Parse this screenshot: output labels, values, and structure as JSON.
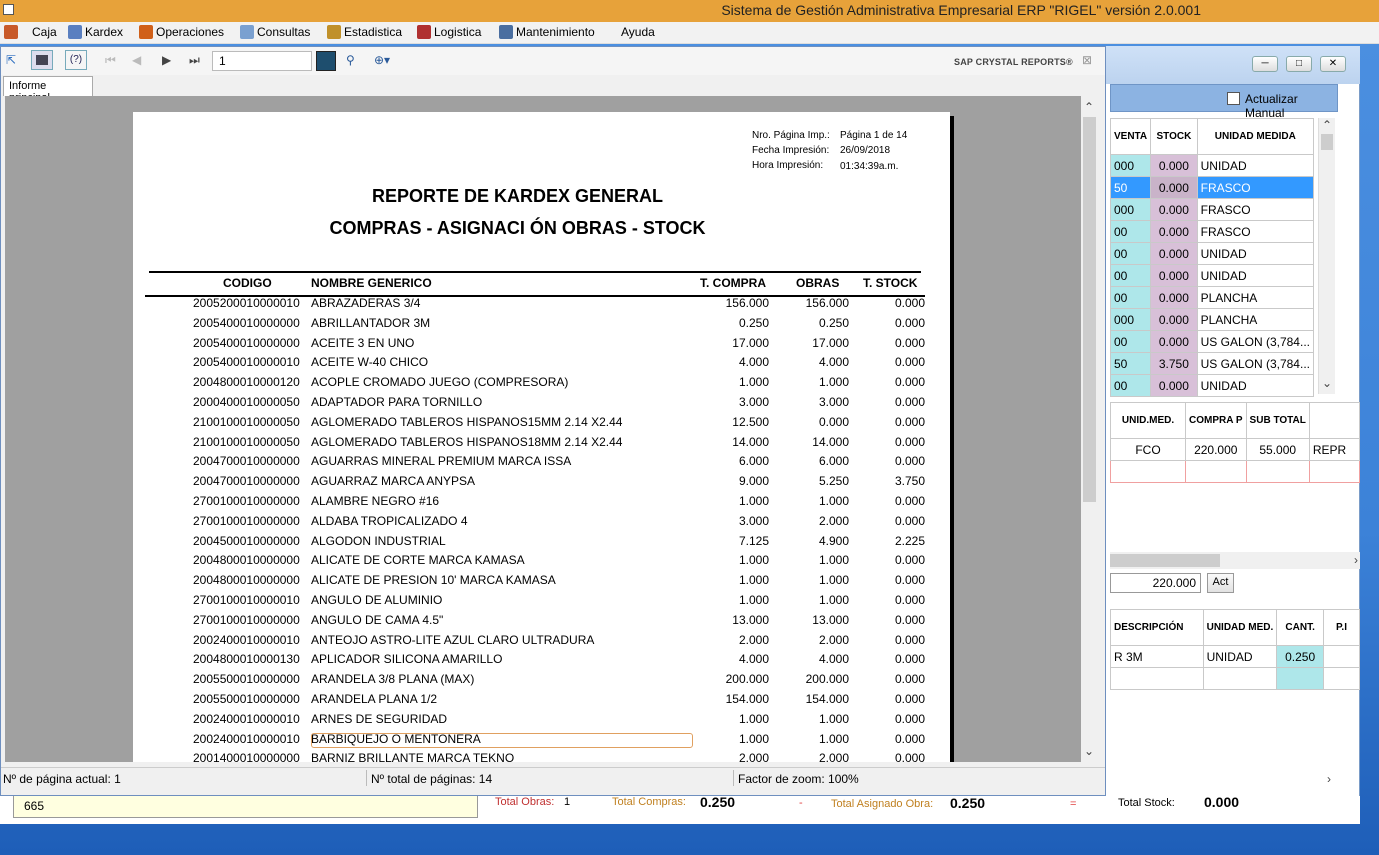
{
  "app": {
    "title": "Sistema de Gestión Administrativa Empresarial ERP  \"RIGEL\" versión 2.0.001"
  },
  "menu": [
    "Caja",
    "Kardex",
    "Operaciones",
    "Consultas",
    "Estadistica",
    "Logistica",
    "Mantenimiento",
    "Ayuda"
  ],
  "toolbar": {
    "page_value": "1",
    "brand": "SAP CRYSTAL REPORTS®",
    "tab_label": "Informe principal"
  },
  "report": {
    "meta": {
      "page_label": "Nro. Página Imp.:",
      "page_value": "Página 1 de 14",
      "date_label": "Fecha Impresión:",
      "date_value": "26/09/2018",
      "time_label": "Hora Impresión:",
      "time_value": "01:34:39a.m."
    },
    "title": "REPORTE DE KARDEX GENERAL",
    "subtitle": "COMPRAS - ASIGNACI ÓN OBRAS - STOCK",
    "columns": {
      "code": "CODIGO",
      "name": "NOMBRE GENERICO",
      "compra": "T. COMPRA",
      "obras": "OBRAS",
      "stock": "T. STOCK"
    },
    "rows": [
      [
        "2005200010000010",
        "ABRAZADERAS 3/4",
        "156.000",
        "156.000",
        "0.000"
      ],
      [
        "2005400010000000",
        "ABRILLANTADOR 3M",
        "0.250",
        "0.250",
        "0.000"
      ],
      [
        "2005400010000000",
        "ACEITE 3 EN UNO",
        "17.000",
        "17.000",
        "0.000"
      ],
      [
        "2005400010000010",
        "ACEITE W-40 CHICO",
        "4.000",
        "4.000",
        "0.000"
      ],
      [
        "2004800010000120",
        "ACOPLE CROMADO JUEGO (COMPRESORA)",
        "1.000",
        "1.000",
        "0.000"
      ],
      [
        "2000400010000050",
        "ADAPTADOR PARA TORNILLO",
        "3.000",
        "3.000",
        "0.000"
      ],
      [
        "2100100010000050",
        "AGLOMERADO TABLEROS HISPANOS15MM 2.14 X2.44",
        "12.500",
        "0.000",
        "0.000"
      ],
      [
        "2100100010000050",
        "AGLOMERADO TABLEROS HISPANOS18MM 2.14 X2.44",
        "14.000",
        "14.000",
        "0.000"
      ],
      [
        "2004700010000000",
        "AGUARRAS MINERAL PREMIUM MARCA ISSA",
        "6.000",
        "6.000",
        "0.000"
      ],
      [
        "2004700010000000",
        "AGUARRAZ MARCA ANYPSA",
        "9.000",
        "5.250",
        "3.750"
      ],
      [
        "2700100010000000",
        "ALAMBRE NEGRO #16",
        "1.000",
        "1.000",
        "0.000"
      ],
      [
        "2700100010000000",
        "ALDABA TROPICALIZADO 4",
        "3.000",
        "2.000",
        "0.000"
      ],
      [
        "2004500010000000",
        "ALGODON INDUSTRIAL",
        "7.125",
        "4.900",
        "2.225"
      ],
      [
        "2004800010000000",
        "ALICATE DE CORTE MARCA KAMASA",
        "1.000",
        "1.000",
        "0.000"
      ],
      [
        "2004800010000000",
        "ALICATE DE PRESION 10' MARCA KAMASA",
        "1.000",
        "1.000",
        "0.000"
      ],
      [
        "2700100010000010",
        "ANGULO DE ALUMINIO",
        "1.000",
        "1.000",
        "0.000"
      ],
      [
        "2700100010000000",
        "ANGULO DE CAMA 4.5\"",
        "13.000",
        "13.000",
        "0.000"
      ],
      [
        "2002400010000010",
        "ANTEOJO ASTRO-LITE AZUL CLARO ULTRADURA",
        "2.000",
        "2.000",
        "0.000"
      ],
      [
        "2004800010000130",
        "APLICADOR SILICONA AMARILLO",
        "4.000",
        "4.000",
        "0.000"
      ],
      [
        "2005500010000000",
        "ARANDELA 3/8 PLANA (MAX)",
        "200.000",
        "200.000",
        "0.000"
      ],
      [
        "2005500010000000",
        "ARANDELA PLANA 1/2",
        "154.000",
        "154.000",
        "0.000"
      ],
      [
        "2002400010000010",
        "ARNES DE SEGURIDAD",
        "1.000",
        "1.000",
        "0.000"
      ],
      [
        "2002400010000010",
        "BARBIQUEJO O MENTONERA",
        "1.000",
        "1.000",
        "0.000"
      ],
      [
        "2001400010000000",
        "BARNIZ BRILLANTE MARCA TEKNO",
        "2.000",
        "2.000",
        "0.000"
      ]
    ]
  },
  "status": {
    "current_page": "Nº de página actual: 1",
    "total_pages": "Nº total de páginas: 14",
    "zoom": "Factor de zoom: 100%"
  },
  "bg_window": {
    "manual_label": "Actualizar Manual",
    "stock_headers": [
      "VENTA",
      "STOCK",
      "UNIDAD MEDIDA"
    ],
    "stock_rows": [
      [
        "000",
        "0.000",
        "UNIDAD"
      ],
      [
        "50",
        "0.000",
        "FRASCO"
      ],
      [
        "000",
        "0.000",
        "FRASCO"
      ],
      [
        "00",
        "0.000",
        "FRASCO"
      ],
      [
        "00",
        "0.000",
        "UNIDAD"
      ],
      [
        "00",
        "0.000",
        "UNIDAD"
      ],
      [
        "00",
        "0.000",
        "PLANCHA"
      ],
      [
        "000",
        "0.000",
        "PLANCHA"
      ],
      [
        "00",
        "0.000",
        "US GALON (3,784..."
      ],
      [
        "50",
        "3.750",
        "US GALON (3,784..."
      ],
      [
        "00",
        "0.000",
        "UNIDAD"
      ]
    ],
    "compra_headers": [
      "UNID.MED.",
      "COMPRA P",
      "SUB TOTAL",
      ""
    ],
    "compra_row": [
      "FCO",
      "220.000",
      "55.000",
      "REPR"
    ],
    "price_value": "220.000",
    "act_label": "Act",
    "desc_headers": [
      "DESCRIPCIÓN",
      "UNIDAD MED.",
      "CANT.",
      "P.I"
    ],
    "desc_row": [
      "R 3M",
      "UNIDAD",
      "0.250",
      ""
    ]
  },
  "footer": {
    "field_value": "665",
    "total_obras_label": "Total Obras:",
    "total_obras_value": "1",
    "total_compras_label": "Total Compras:",
    "total_compras_value": "0.250",
    "minus": "-",
    "total_asignado_label": "Total Asignado Obra:",
    "total_asignado_value": "0.250",
    "equals": "=",
    "total_stock_label": "Total Stock:",
    "total_stock_value": "0.000"
  }
}
